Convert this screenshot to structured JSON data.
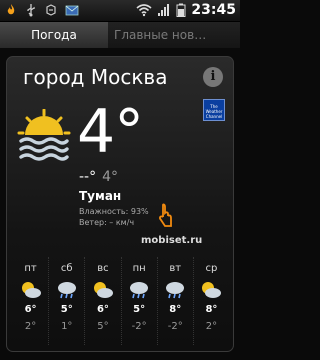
{
  "status": {
    "time": "23:45"
  },
  "tabs": [
    {
      "label": "Погода"
    },
    {
      "label": "Главные нов…"
    }
  ],
  "weather": {
    "city": "город Москва",
    "temp": "4°",
    "high": "--°",
    "low": "4°",
    "condition": "Туман",
    "humidity": "Влажность: 93%",
    "wind": "Ветер: – км/ч",
    "logo_text": "The Weather Channel"
  },
  "watermark": "mobiset.ru",
  "forecast": [
    {
      "day": "пт",
      "hi": "6°",
      "lo": "2°",
      "icon": "sun-cloud-icon"
    },
    {
      "day": "сб",
      "hi": "5°",
      "lo": "1°",
      "icon": "rain-icon"
    },
    {
      "day": "вс",
      "hi": "6°",
      "lo": "5°",
      "icon": "sun-cloud-icon"
    },
    {
      "day": "пн",
      "hi": "5°",
      "lo": "-2°",
      "icon": "rain-icon"
    },
    {
      "day": "вт",
      "hi": "8°",
      "lo": "-2°",
      "icon": "rain-icon"
    },
    {
      "day": "ср",
      "hi": "8°",
      "lo": "2°",
      "icon": "sun-cloud-icon"
    }
  ],
  "colors": {
    "sun": "#f0c020",
    "cloud": "#cfd8e0",
    "rain": "#6fa8ff",
    "logo": "#0a3fa0"
  }
}
